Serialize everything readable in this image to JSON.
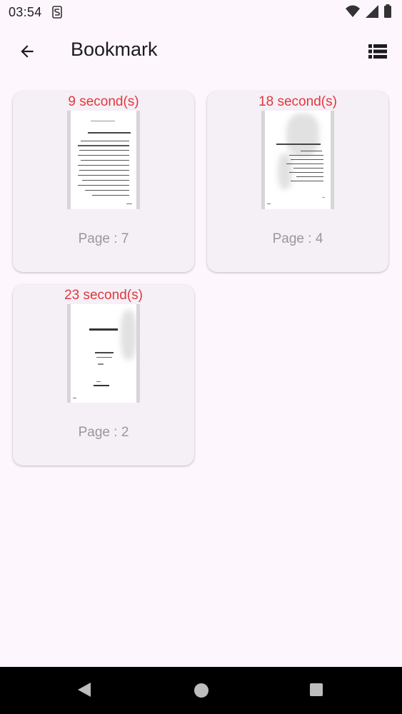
{
  "status_bar": {
    "time": "03:54",
    "icons": [
      "s-sync-icon",
      "wifi-icon",
      "cellular-signal-icon",
      "battery-icon"
    ]
  },
  "app_bar": {
    "title": "Bookmark",
    "back_icon": "arrow-left-icon",
    "view_icon": "view-list-icon"
  },
  "bookmarks": [
    {
      "duration": "9 second(s)",
      "page": "Page : 7"
    },
    {
      "duration": "18 second(s)",
      "page": "Page : 4"
    },
    {
      "duration": "23 second(s)",
      "page": "Page : 2"
    }
  ],
  "colors": {
    "background": "#fdf7fd",
    "card": "#f5eff6",
    "duration_text": "#e0383c",
    "page_text": "#9a979c"
  },
  "nav_bar": {
    "icons": [
      "back-triangle-icon",
      "home-circle-icon",
      "recents-square-icon"
    ]
  }
}
